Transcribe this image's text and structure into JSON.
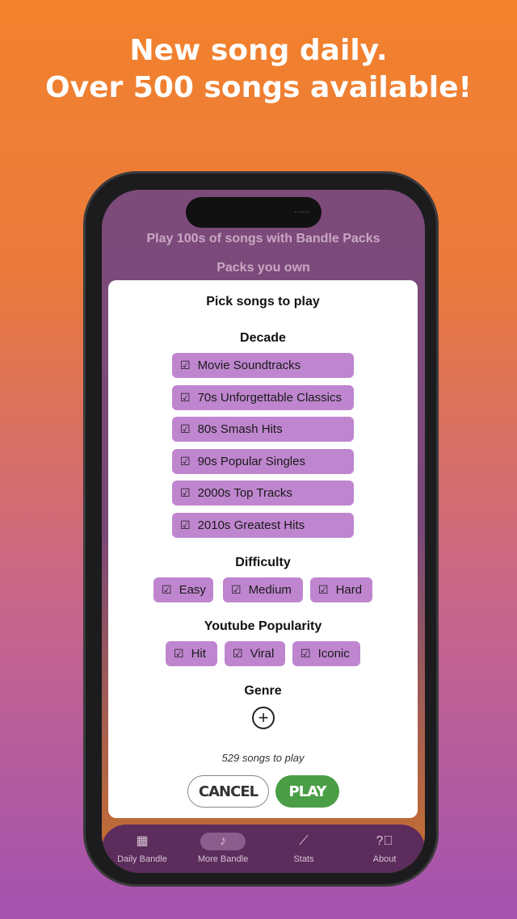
{
  "headline": {
    "line1": "New song daily.",
    "line2": "Over 500 songs available!"
  },
  "screen": {
    "packs_title": "Play 100s of songs with Bandle Packs",
    "packs_own": "Packs you own"
  },
  "modal": {
    "title": "Pick songs to play",
    "decade_title": "Decade",
    "decades": [
      "Movie Soundtracks",
      "70s Unforgettable Classics",
      "80s Smash Hits",
      "90s Popular Singles",
      "2000s Top Tracks",
      "2010s Greatest Hits"
    ],
    "difficulty_title": "Difficulty",
    "difficulties": [
      "Easy",
      "Medium",
      "Hard"
    ],
    "popularity_title": "Youtube Popularity",
    "popularity": [
      "Hit",
      "Viral",
      "Iconic"
    ],
    "genre_title": "Genre",
    "count": "529 songs to play",
    "cancel": "CANCEL",
    "play": "PLAY",
    "chip_color": "#bf86cf",
    "play_color": "#4a9e45"
  },
  "nav": [
    {
      "label": "Daily Bandle",
      "icon": "calendar-icon"
    },
    {
      "label": "More Bandle",
      "icon": "music-note-icon",
      "active": true
    },
    {
      "label": "Stats",
      "icon": "chart-icon"
    },
    {
      "label": "About",
      "icon": "help-bubble-icon"
    }
  ]
}
